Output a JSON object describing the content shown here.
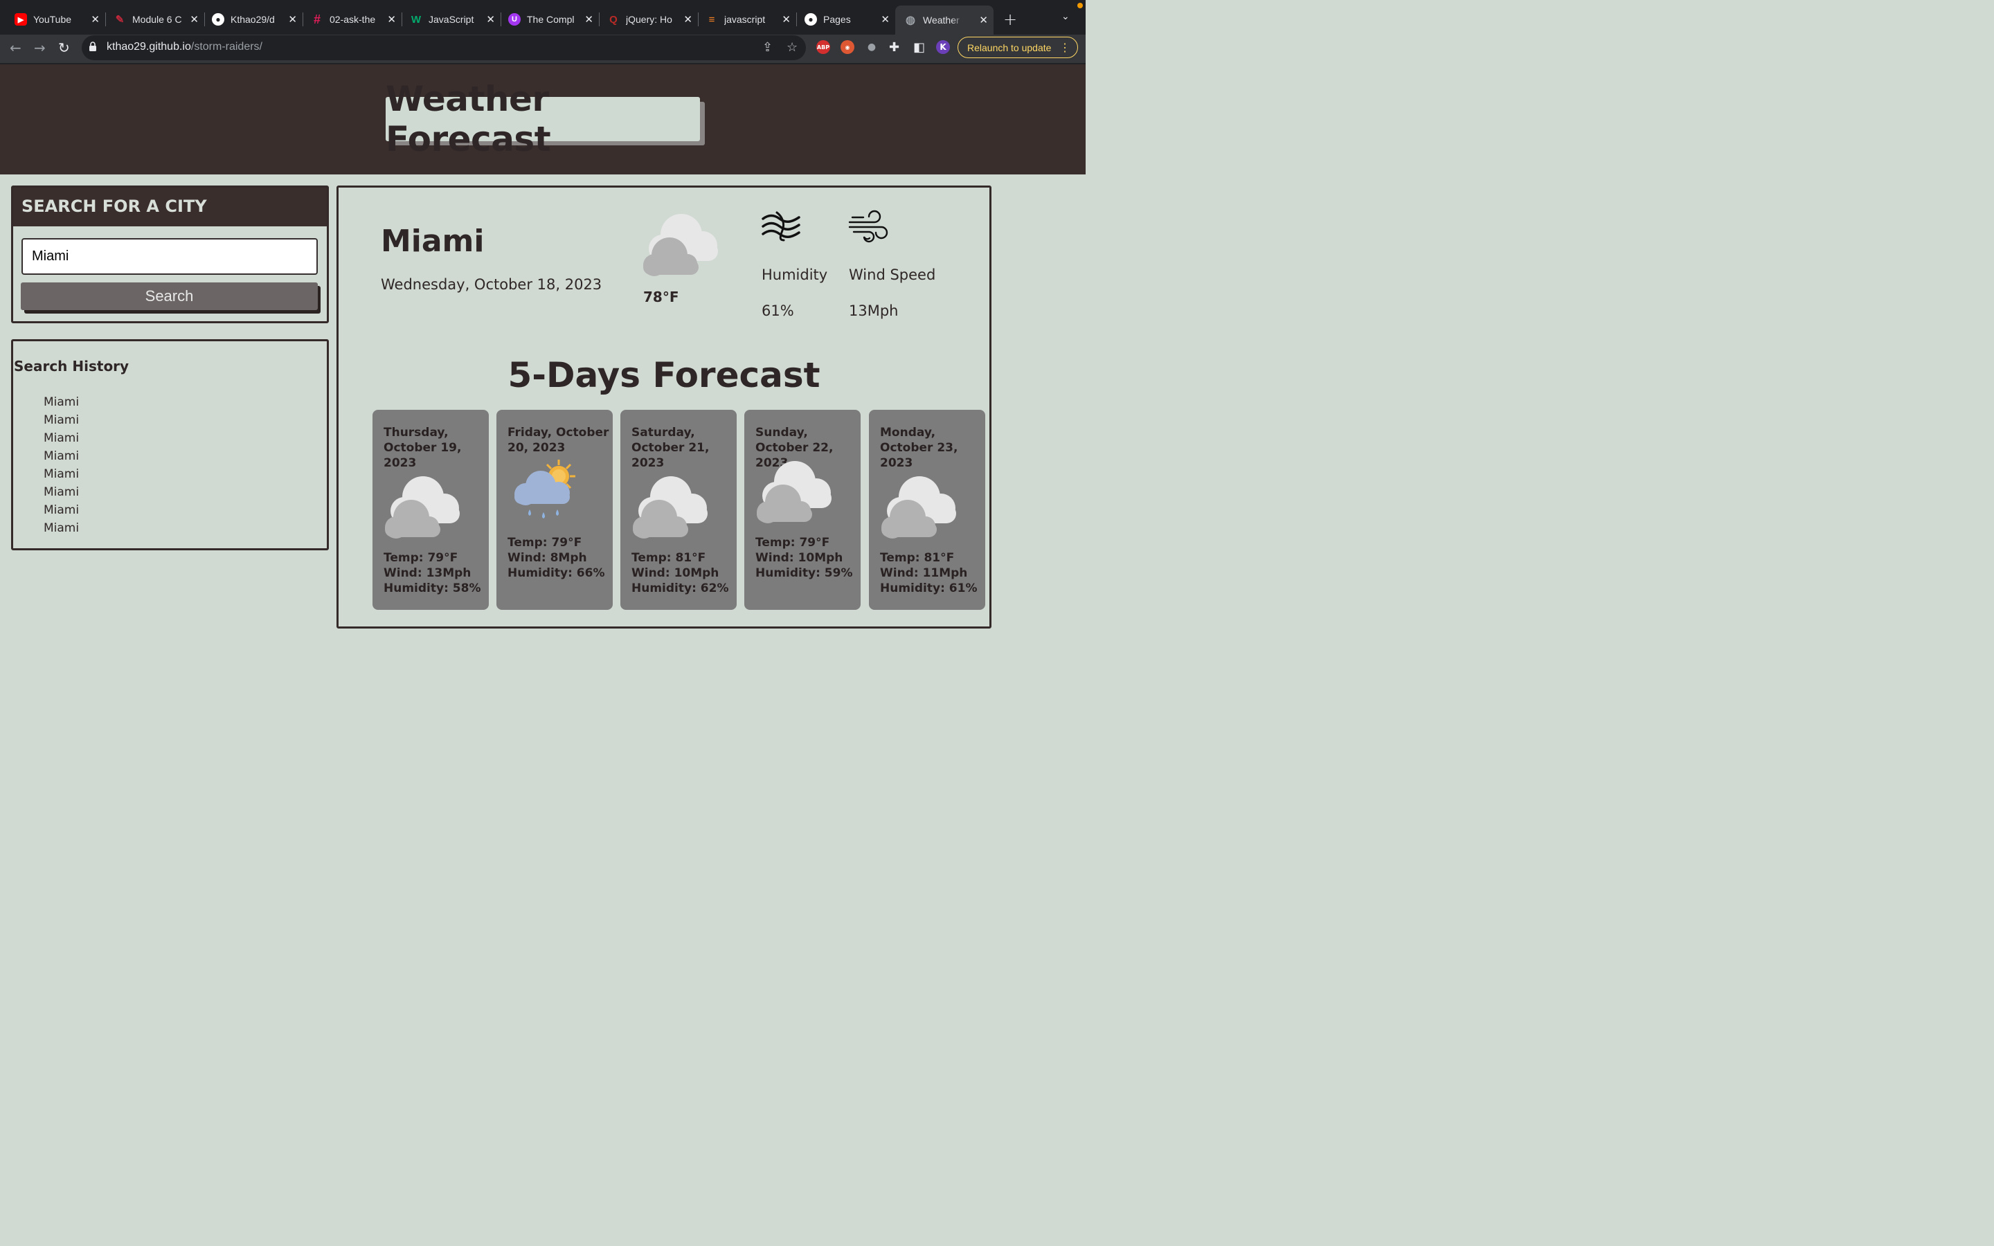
{
  "browser": {
    "tabs": [
      {
        "title": "YouTube",
        "favicon": "youtube-icon",
        "color": "#ff0000",
        "glyph": "▶"
      },
      {
        "title": "Module 6 C",
        "favicon": "module-icon",
        "color": "#c0283b",
        "glyph": "✎"
      },
      {
        "title": "Kthao29/d",
        "favicon": "github-icon",
        "color": "#ffffff",
        "glyph": "●"
      },
      {
        "title": "02-ask-the",
        "favicon": "slack-icon",
        "color": "#e01e5a",
        "glyph": "#"
      },
      {
        "title": "JavaScript",
        "favicon": "w3schools-icon",
        "color": "#04aa6d",
        "glyph": "W"
      },
      {
        "title": "The Compl",
        "favicon": "udemy-icon",
        "color": "#a435f0",
        "glyph": "U"
      },
      {
        "title": "jQuery: Ho",
        "favicon": "quora-icon",
        "color": "#b92b27",
        "glyph": "Q"
      },
      {
        "title": "javascript",
        "favicon": "stackoverflow-icon",
        "color": "#f48024",
        "glyph": "≡"
      },
      {
        "title": "Pages",
        "favicon": "github-icon",
        "color": "#ffffff",
        "glyph": "●"
      },
      {
        "title": "Weather Fo",
        "favicon": "globe-icon",
        "color": "#9aa0a6",
        "glyph": "◍"
      }
    ],
    "url_host": "kthao29.github.io",
    "url_path": "/storm-raiders/",
    "profile_initial": "K",
    "relaunch_label": "Relaunch to update",
    "abp_label": "ABP"
  },
  "page": {
    "title": "Weather Forecast",
    "search": {
      "heading": "SEARCH FOR A CITY",
      "input_value": "Miami",
      "button_label": "Search"
    },
    "history": {
      "title": "Search History",
      "items": [
        "Miami",
        "Miami",
        "Miami",
        "Miami",
        "Miami",
        "Miami",
        "Miami",
        "Miami"
      ]
    },
    "current": {
      "city": "Miami",
      "date": "Wednesday, October 18, 2023",
      "temp": "78°F",
      "icon": "cloudy-icon",
      "humidity_label": "Humidity",
      "humidity_value": "61%",
      "wind_label": "Wind Speed",
      "wind_value": "13Mph"
    },
    "forecast_title": "5-Days Forecast",
    "forecast": [
      {
        "date": "Thursday, October 19, 2023",
        "icon": "cloudy-icon",
        "temp": "Temp: 79°F",
        "wind": "Wind: 13Mph",
        "humidity": "Humidity: 58%"
      },
      {
        "date": "Friday, October 20, 2023",
        "icon": "rain-sun-icon",
        "temp": "Temp: 79°F",
        "wind": "Wind: 8Mph",
        "humidity": "Humidity: 66%"
      },
      {
        "date": "Saturday, October 21, 2023",
        "icon": "cloudy-icon",
        "temp": "Temp: 81°F",
        "wind": "Wind: 10Mph",
        "humidity": "Humidity: 62%"
      },
      {
        "date": "Sunday, October 22, 2023",
        "icon": "cloudy-icon",
        "temp": "Temp: 79°F",
        "wind": "Wind: 10Mph",
        "humidity": "Humidity: 59%"
      },
      {
        "date": "Monday, October 23, 2023",
        "icon": "cloudy-icon",
        "temp": "Temp: 81°F",
        "wind": "Wind: 11Mph",
        "humidity": "Humidity: 61%"
      }
    ]
  }
}
